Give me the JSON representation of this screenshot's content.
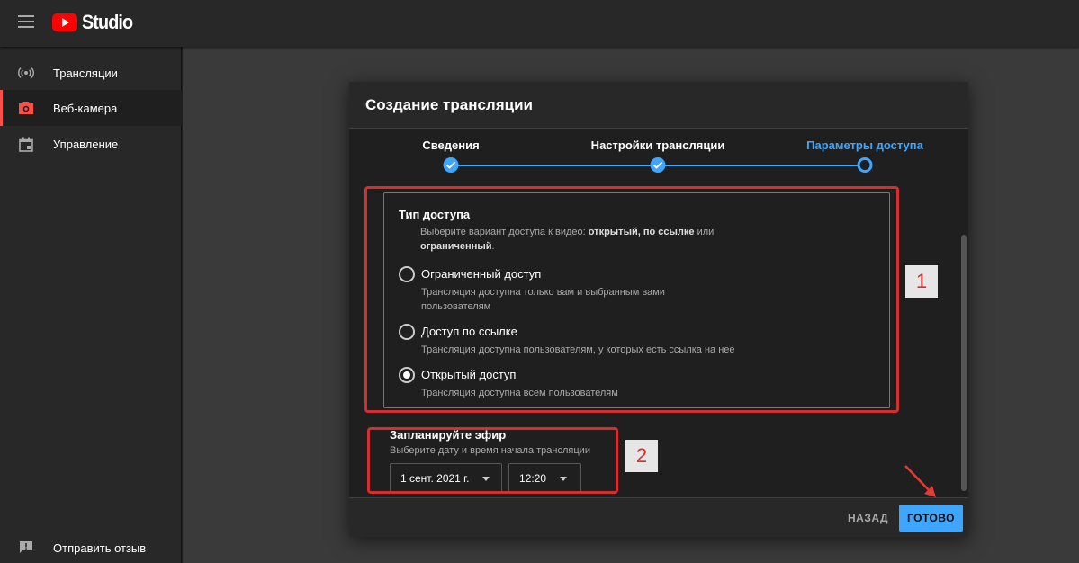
{
  "app": {
    "logo_text": "Studio"
  },
  "sidebar": {
    "items": [
      {
        "label": "Трансляции",
        "icon": "broadcast-icon"
      },
      {
        "label": "Веб-камера",
        "icon": "camera-icon"
      },
      {
        "label": "Управление",
        "icon": "calendar-icon"
      }
    ],
    "feedback_label": "Отправить отзыв"
  },
  "dialog": {
    "title": "Создание трансляции",
    "steps": [
      {
        "label": "Сведения",
        "state": "done"
      },
      {
        "label": "Настройки трансляции",
        "state": "done"
      },
      {
        "label": "Параметры доступа",
        "state": "current"
      }
    ],
    "access": {
      "title": "Тип доступа",
      "desc_prefix": "Выберите вариант доступа к видео: ",
      "desc_opt1": "открытый",
      "desc_sep": ", ",
      "desc_opt2": "по ссылке",
      "desc_or": " или",
      "desc_opt3": "ограниченный",
      "desc_end": ".",
      "options": [
        {
          "label": "Ограниченный доступ",
          "desc": "Трансляция доступна только вам и выбранным вами пользователям",
          "checked": false
        },
        {
          "label": "Доступ по ссылке",
          "desc": "Трансляция доступна пользователям, у которых есть ссылка на нее",
          "checked": false
        },
        {
          "label": "Открытый доступ",
          "desc": "Трансляция доступна всем пользователям",
          "checked": true
        }
      ]
    },
    "schedule": {
      "title": "Запланируйте эфир",
      "desc": "Выберите дату и время начала трансляции",
      "date": "1 сент. 2021 г.",
      "time": "12:20"
    },
    "back_label": "НАЗАД",
    "done_label": "ГОТОВО"
  },
  "annotations": {
    "box1": "1",
    "box2": "2"
  },
  "colors": {
    "accent": "#3ea6ff",
    "annotation": "#d32f2f",
    "brand_red": "#ff0000"
  }
}
